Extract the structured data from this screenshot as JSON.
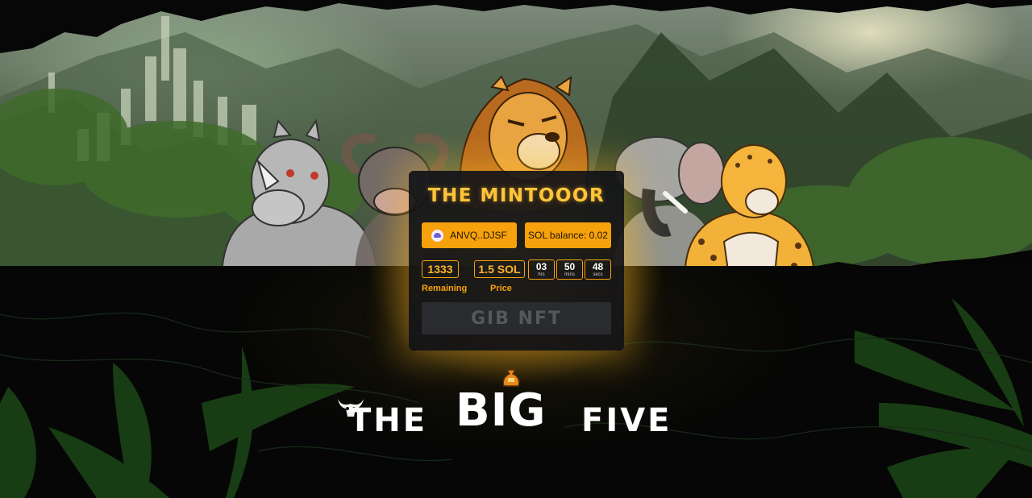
{
  "colors": {
    "accent": "#f7a20c",
    "title": "#ffc53a",
    "card_bg": "#161618",
    "disabled_button": "#2a2b2e"
  },
  "mint_card": {
    "title": "THE MINTOOOR",
    "wallet": {
      "icon": "phantom-wallet-icon",
      "label": "ANVQ..DJSF"
    },
    "sol_balance": "SOL balance: 0.02",
    "remaining": {
      "value": "1333",
      "label": "Remaining"
    },
    "price": {
      "value": "1.5 SOL",
      "label": "Price"
    },
    "countdown": {
      "hours": "03",
      "hours_unit": "hrs",
      "minutes": "50",
      "minutes_unit": "mins",
      "seconds": "48",
      "seconds_unit": "secs"
    },
    "mint_button": "GIB NFT",
    "mint_progress_fraction": 0.0
  },
  "logo": {
    "word_the": "THE",
    "word_big": "BIG",
    "word_five": "FIVE",
    "icons": [
      "buffalo-skull-icon",
      "money-bag-icon"
    ]
  },
  "hero_characters": [
    "rhino",
    "buffalo",
    "lion",
    "elephant",
    "leopard"
  ]
}
